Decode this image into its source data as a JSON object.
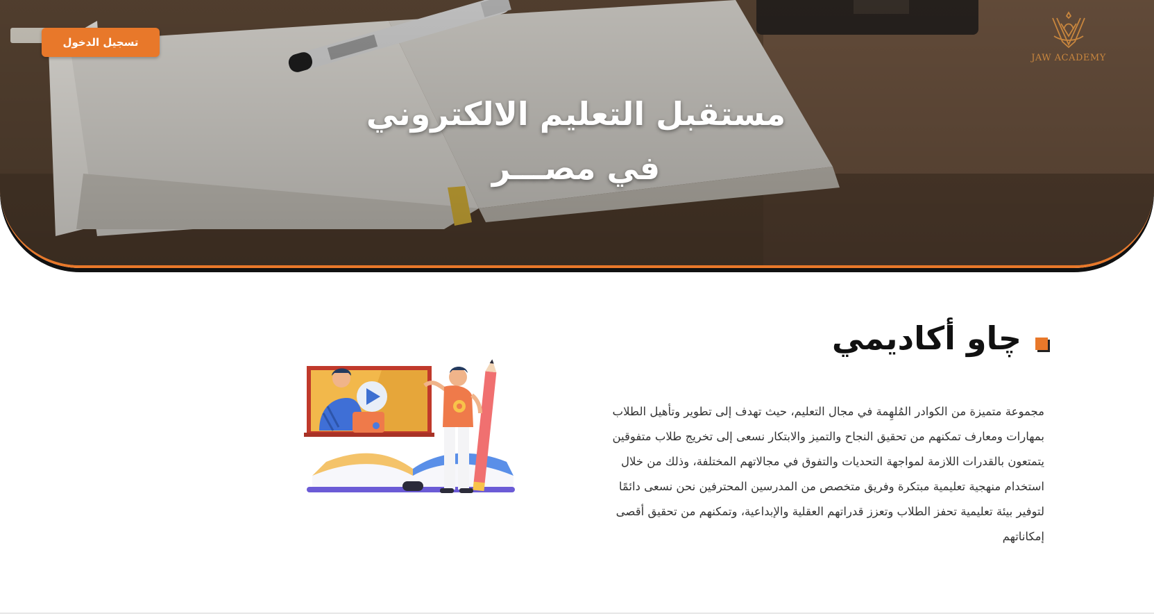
{
  "header": {
    "login_label": "تسجيل الدخول",
    "logo_text": "JAW ACADEMY",
    "hero_title_line1": "مستقبل التعليم الالكتروني",
    "hero_title_line2": "في مصـــر"
  },
  "about": {
    "heading": "چاو أكاديمي",
    "paragraph": "مجموعة متميزة من الكوادر المُلهِمة في مجال التعليم، حيث تهدف إلى تطوير وتأهيل الطلاب بمهارات ومعارف تمكنهم من تحقيق النجاح والتميز والابتكار نسعى إلى تخريج طلاب متفوقين يتمتعون بالقدرات اللازمة لمواجهة التحديات والتفوق في مجالاتهم المختلفة، وذلك من خلال استخدام منهجية تعليمية مبتكرة وفريق متخصص من المدرسين المحترفين نحن نسعى دائمًا لتوفير بيئة تعليمية تحفز الطلاب وتعزز قدراتهم العقلية والإبداعية، وتمكنهم من تحقيق أقصى إمكاناتهم"
  },
  "colors": {
    "accent": "#e8782a",
    "logo": "#c8863e",
    "heading": "#111111",
    "body_text": "#333333"
  },
  "icons": {
    "logo": "jaw-academy-emblem-icon",
    "bullet": "square-bullet-icon",
    "illustration": "online-learning-illustration"
  }
}
